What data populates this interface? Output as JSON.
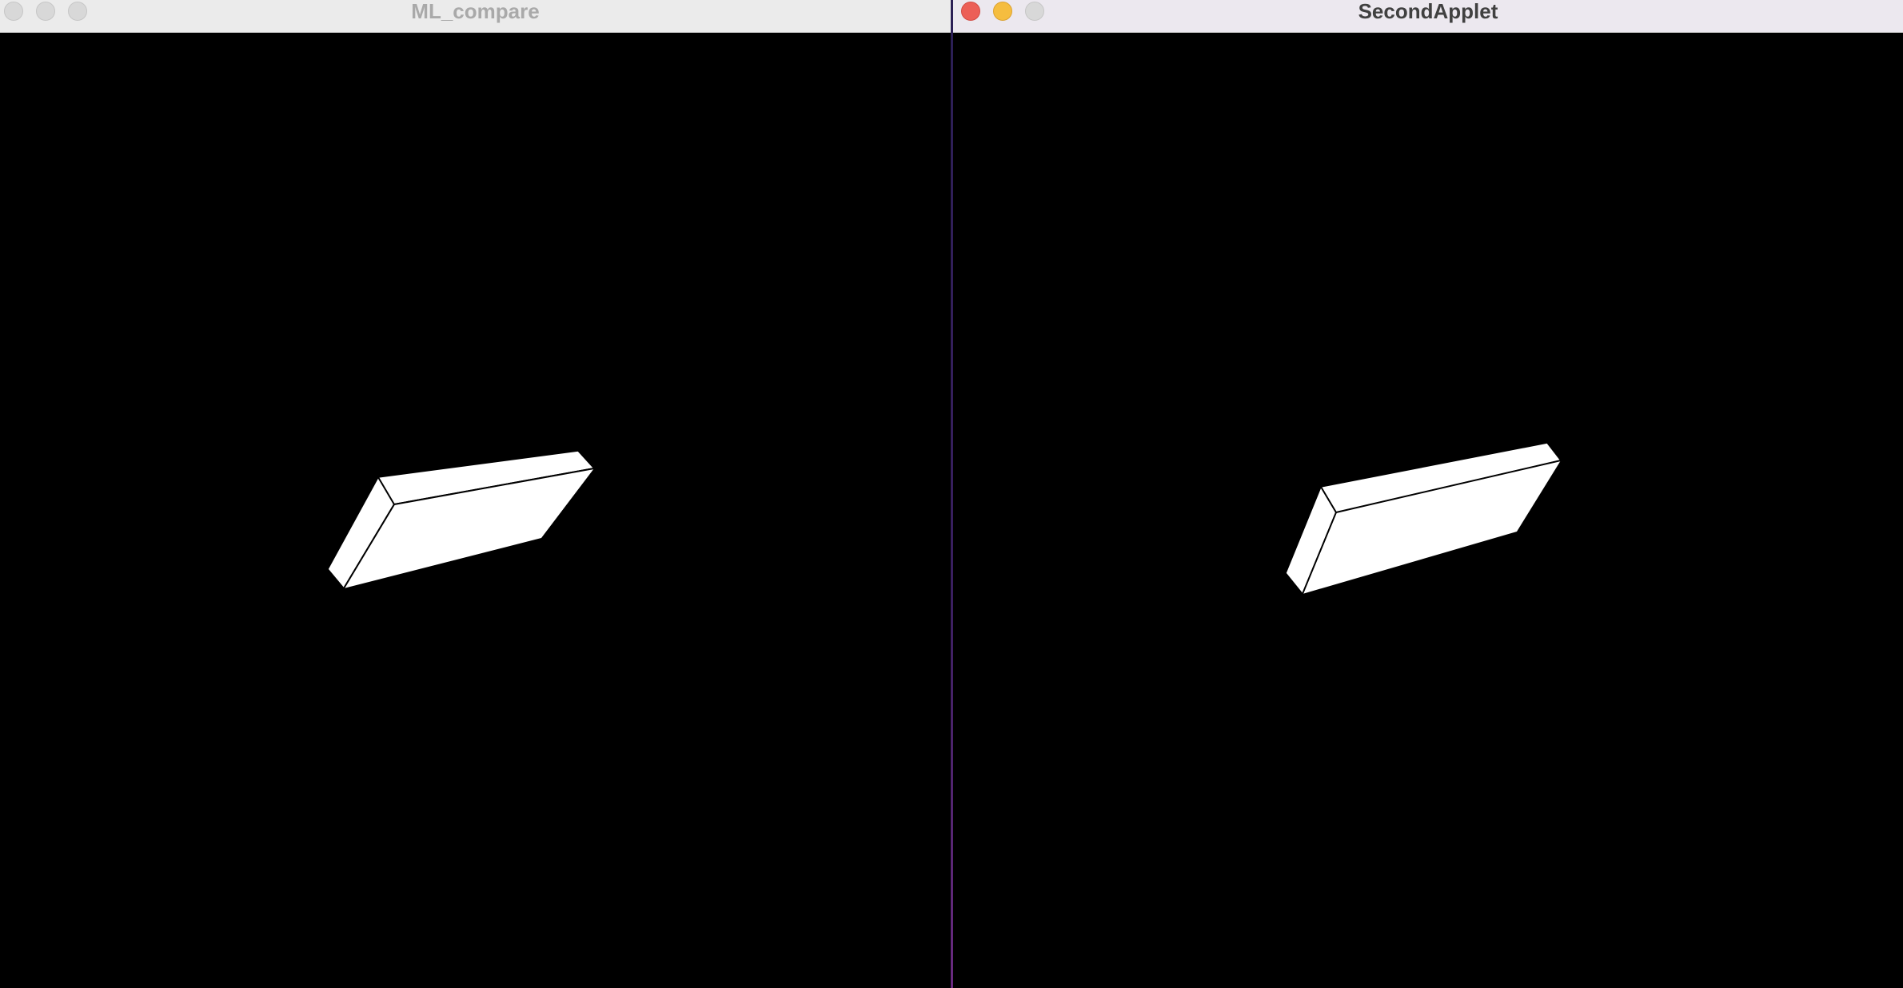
{
  "windows": {
    "left": {
      "title": "ML_compare",
      "state": "inactive"
    },
    "right": {
      "title": "SecondApplet",
      "state": "active"
    }
  },
  "icons": {
    "close": "close-icon",
    "minimize": "minimize-icon",
    "zoom": "zoom-icon"
  },
  "colors": {
    "canvas_background": "#000000",
    "shape_fill": "#ffffff",
    "shape_edge": "#000000",
    "close_active": "#ec5f57",
    "minimize_active": "#f5bd3f"
  }
}
